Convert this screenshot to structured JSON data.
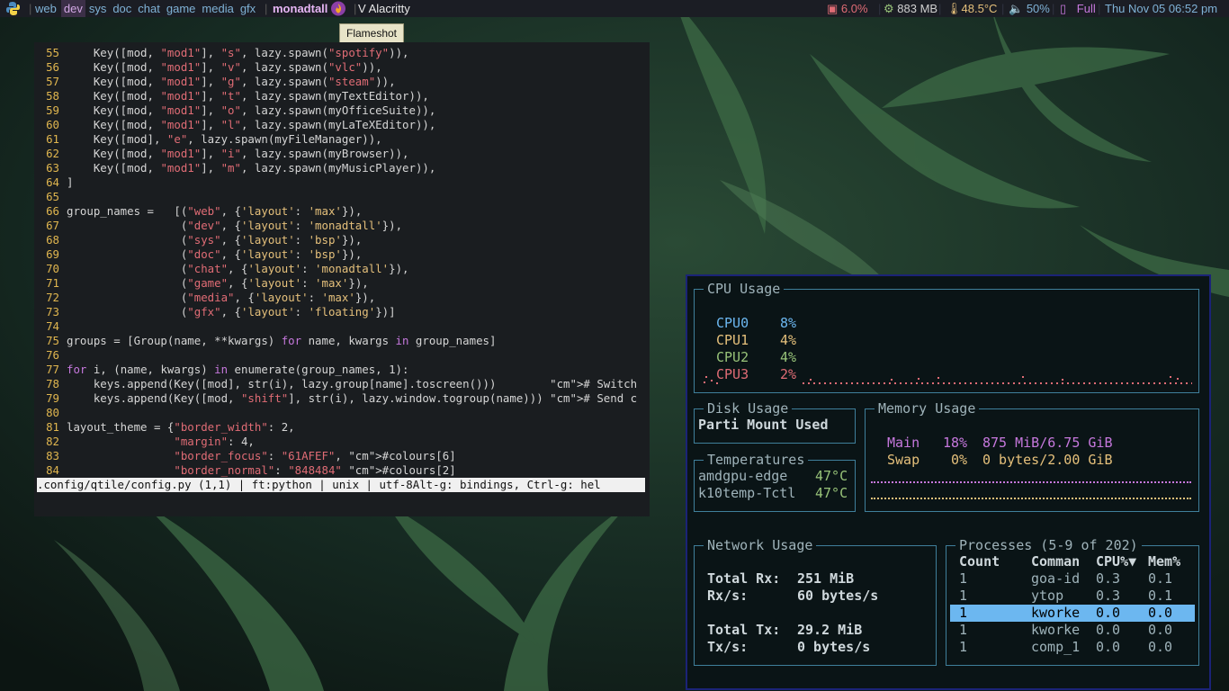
{
  "colors": {
    "bar_bg": "#1b1d24",
    "group_active_bg": "#3b2f47",
    "cpu0": "#6cb7f0",
    "cpu1": "#e5c07b",
    "cpu2": "#98c379",
    "cpu3": "#e06c75",
    "mem_main": "#c678dd",
    "mem_swap": "#e5c07b",
    "ytop_border": "#1b2377",
    "box_border": "#3f7f9b",
    "selected_row": "#6cb7f0"
  },
  "bar": {
    "python_icon": "python-logo-icon",
    "groups": [
      {
        "label": "web",
        "state": "other"
      },
      {
        "label": "dev",
        "state": "active"
      },
      {
        "label": "sys",
        "state": "other"
      },
      {
        "label": "doc",
        "state": "other"
      },
      {
        "label": "chat",
        "state": "other"
      },
      {
        "label": "game",
        "state": "other"
      },
      {
        "label": "media",
        "state": "other"
      },
      {
        "label": "gfx",
        "state": "other"
      }
    ],
    "layout": "monadtall",
    "window_title": "V Alacritty",
    "cpu": "6.0%",
    "mem": "883 MB",
    "temp": "48.5°C",
    "volume": "50%",
    "battery": "Full",
    "clock": "Thu Nov 05  06:52 pm"
  },
  "tooltip": "Flameshot",
  "editor": {
    "lines": [
      {
        "no": "55",
        "t": "    Key([mod, \"mod1\"], \"s\", lazy.spawn(\"spotify\")),"
      },
      {
        "no": "56",
        "t": "    Key([mod, \"mod1\"], \"v\", lazy.spawn(\"vlc\")),"
      },
      {
        "no": "57",
        "t": "    Key([mod, \"mod1\"], \"g\", lazy.spawn(\"steam\")),"
      },
      {
        "no": "58",
        "t": "    Key([mod, \"mod1\"], \"t\", lazy.spawn(myTextEditor)),"
      },
      {
        "no": "59",
        "t": "    Key([mod, \"mod1\"], \"o\", lazy.spawn(myOfficeSuite)),"
      },
      {
        "no": "60",
        "t": "    Key([mod, \"mod1\"], \"l\", lazy.spawn(myLaTeXEditor)),"
      },
      {
        "no": "61",
        "t": "    Key([mod], \"e\", lazy.spawn(myFileManager)),"
      },
      {
        "no": "62",
        "t": "    Key([mod, \"mod1\"], \"i\", lazy.spawn(myBrowser)),"
      },
      {
        "no": "63",
        "t": "    Key([mod, \"mod1\"], \"m\", lazy.spawn(myMusicPlayer)),"
      },
      {
        "no": "64",
        "t": "]"
      },
      {
        "no": "65",
        "t": ""
      },
      {
        "no": "66",
        "t": "group_names =   [(\"web\", {'layout': 'max'}),"
      },
      {
        "no": "67",
        "t": "                 (\"dev\", {'layout': 'monadtall'}),"
      },
      {
        "no": "68",
        "t": "                 (\"sys\", {'layout': 'bsp'}),"
      },
      {
        "no": "69",
        "t": "                 (\"doc\", {'layout': 'bsp'}),"
      },
      {
        "no": "70",
        "t": "                 (\"chat\", {'layout': 'monadtall'}),"
      },
      {
        "no": "71",
        "t": "                 (\"game\", {'layout': 'max'}),"
      },
      {
        "no": "72",
        "t": "                 (\"media\", {'layout': 'max'}),"
      },
      {
        "no": "73",
        "t": "                 (\"gfx\", {'layout': 'floating'})]"
      },
      {
        "no": "74",
        "t": ""
      },
      {
        "no": "75",
        "t": "groups = [Group(name, **kwargs) for name, kwargs in group_names]"
      },
      {
        "no": "76",
        "t": ""
      },
      {
        "no": "77",
        "t": "for i, (name, kwargs) in enumerate(group_names, 1):"
      },
      {
        "no": "78",
        "t": "    keys.append(Key([mod], str(i), lazy.group[name].toscreen()))        # Switch"
      },
      {
        "no": "79",
        "t": "    keys.append(Key([mod, \"shift\"], str(i), lazy.window.togroup(name))) # Send c"
      },
      {
        "no": "80",
        "t": ""
      },
      {
        "no": "81",
        "t": "layout_theme = {\"border_width\": 2,"
      },
      {
        "no": "82",
        "t": "                \"margin\": 4,"
      },
      {
        "no": "83",
        "t": "                \"border_focus\": \"61AFEF\", #colours[6]"
      },
      {
        "no": "84",
        "t": "                \"border_normal\": \"848484\" #colours[2]"
      }
    ],
    "status": ".config/qtile/config.py (1,1) | ft:python | unix | utf-8Alt-g: bindings, Ctrl-g: hel"
  },
  "ytop": {
    "cpu": {
      "title": "CPU Usage",
      "cores": [
        {
          "name": "CPU0",
          "value": "8%"
        },
        {
          "name": "CPU1",
          "value": "4%"
        },
        {
          "name": "CPU2",
          "value": "4%"
        },
        {
          "name": "CPU3",
          "value": "2%"
        }
      ]
    },
    "disk": {
      "title": "Disk Usage",
      "header": "Parti Mount Used"
    },
    "temps": {
      "title": "Temperatures",
      "rows": [
        {
          "name": "amdgpu-edge",
          "value": "47°C"
        },
        {
          "name": "k10temp-Tctl",
          "value": "47°C"
        }
      ]
    },
    "memory": {
      "title": "Memory Usage",
      "rows": [
        {
          "name": "Main",
          "pct": "18%",
          "amount": "875 MiB/6.75 GiB"
        },
        {
          "name": "Swap",
          "pct": "0%",
          "amount": "0 bytes/2.00 GiB"
        }
      ]
    },
    "network": {
      "title": "Network Usage",
      "rx_label": "Total Rx:",
      "rx": "251 MiB",
      "rxs_label": "Rx/s:",
      "rxs": "60 bytes/s",
      "tx_label": "Total Tx:",
      "tx": "29.2 MiB",
      "txs_label": "Tx/s:",
      "txs": "0 bytes/s"
    },
    "processes": {
      "title": "Processes (5-9 of 202)",
      "headers": [
        "Count",
        "Comman",
        "CPU%▼",
        "Mem%"
      ],
      "rows": [
        [
          "1",
          "goa-id",
          "0.3",
          "0.1"
        ],
        [
          "1",
          "ytop",
          "0.3",
          "0.1"
        ],
        [
          "1",
          "kworke",
          "0.0",
          "0.0"
        ],
        [
          "1",
          "kworke",
          "0.0",
          "0.0"
        ],
        [
          "1",
          "comp_1",
          "0.0",
          "0.0"
        ]
      ],
      "selected": 2
    }
  }
}
